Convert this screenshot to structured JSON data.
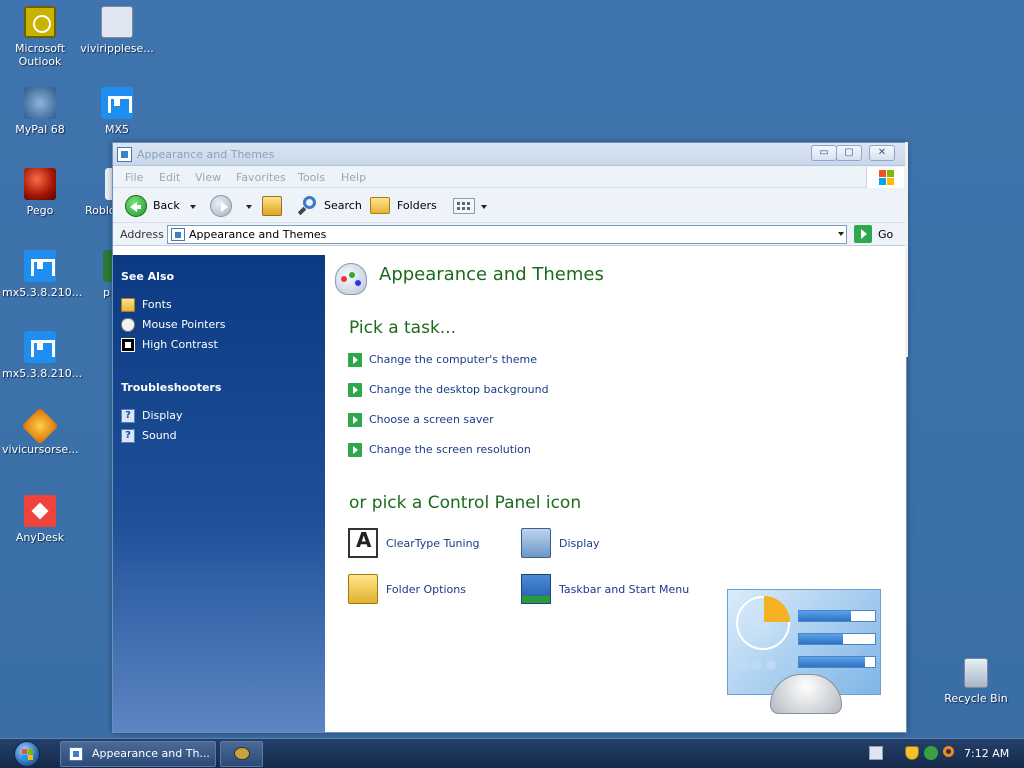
{
  "desktop": {
    "icons": [
      {
        "label": "Microsoft Outlook",
        "icon": "outlook-icon"
      },
      {
        "label": "viviripplese...",
        "icon": "installer-icon"
      },
      {
        "label": "MyPal 68",
        "icon": "mypal-icon"
      },
      {
        "label": "MX5",
        "icon": "maxthon-icon"
      },
      {
        "label": "Pego",
        "icon": "pego-icon"
      },
      {
        "label": "Roblo",
        "icon": "roblox-icon"
      },
      {
        "label": "mx5.3.8.210...",
        "icon": "maxthon-icon"
      },
      {
        "label": "p",
        "icon": "app-icon"
      },
      {
        "label": "mx5.3.8.210...",
        "icon": "maxthon-icon"
      },
      {
        "label": "vivicursorse...",
        "icon": "vivicursor-icon"
      },
      {
        "label": "AnyDesk",
        "icon": "anydesk-icon"
      },
      {
        "label": "Recycle Bin",
        "icon": "recycle-bin-icon"
      }
    ]
  },
  "window": {
    "title": "Appearance and Themes",
    "controls": {
      "minimize": "▭",
      "maximize": "▢",
      "close": "✕"
    },
    "menu": [
      "File",
      "Edit",
      "View",
      "Favorites",
      "Tools",
      "Help"
    ],
    "toolbar": {
      "back": "Back",
      "search": "Search",
      "folders": "Folders"
    },
    "address": {
      "label": "Address",
      "value": "Appearance and Themes",
      "go": "Go"
    },
    "sidebar": {
      "see_also_title": "See Also",
      "see_also": [
        {
          "label": "Fonts",
          "icon": "folder-icon"
        },
        {
          "label": "Mouse Pointers",
          "icon": "mouse-icon"
        },
        {
          "label": "High Contrast",
          "icon": "high-contrast-icon"
        }
      ],
      "troubleshooters_title": "Troubleshooters",
      "troubleshooters": [
        {
          "label": "Display",
          "icon": "help-icon"
        },
        {
          "label": "Sound",
          "icon": "help-icon"
        }
      ]
    },
    "content": {
      "heading": "Appearance and Themes",
      "pick_task": "Pick a task...",
      "tasks": [
        "Change the computer's theme",
        "Change the desktop background",
        "Choose a screen saver",
        "Change the screen resolution"
      ],
      "pick_icon": "or pick a Control Panel icon",
      "icons": [
        {
          "label": "ClearType Tuning",
          "icon": "cleartype-icon"
        },
        {
          "label": "Display",
          "icon": "display-icon"
        },
        {
          "label": "Folder Options",
          "icon": "folder-options-icon"
        },
        {
          "label": "Taskbar and Start Menu",
          "icon": "taskbar-start-menu-icon"
        }
      ]
    }
  },
  "taskbar": {
    "tasks": [
      {
        "label": "Appearance and Th..."
      }
    ],
    "clock": "7:12 AM"
  },
  "colors": {
    "desktop": "#3a6ea5",
    "sidebar": "#0c3a82",
    "heading_green": "#1c6a1c",
    "link_blue": "#1a3c8a"
  }
}
